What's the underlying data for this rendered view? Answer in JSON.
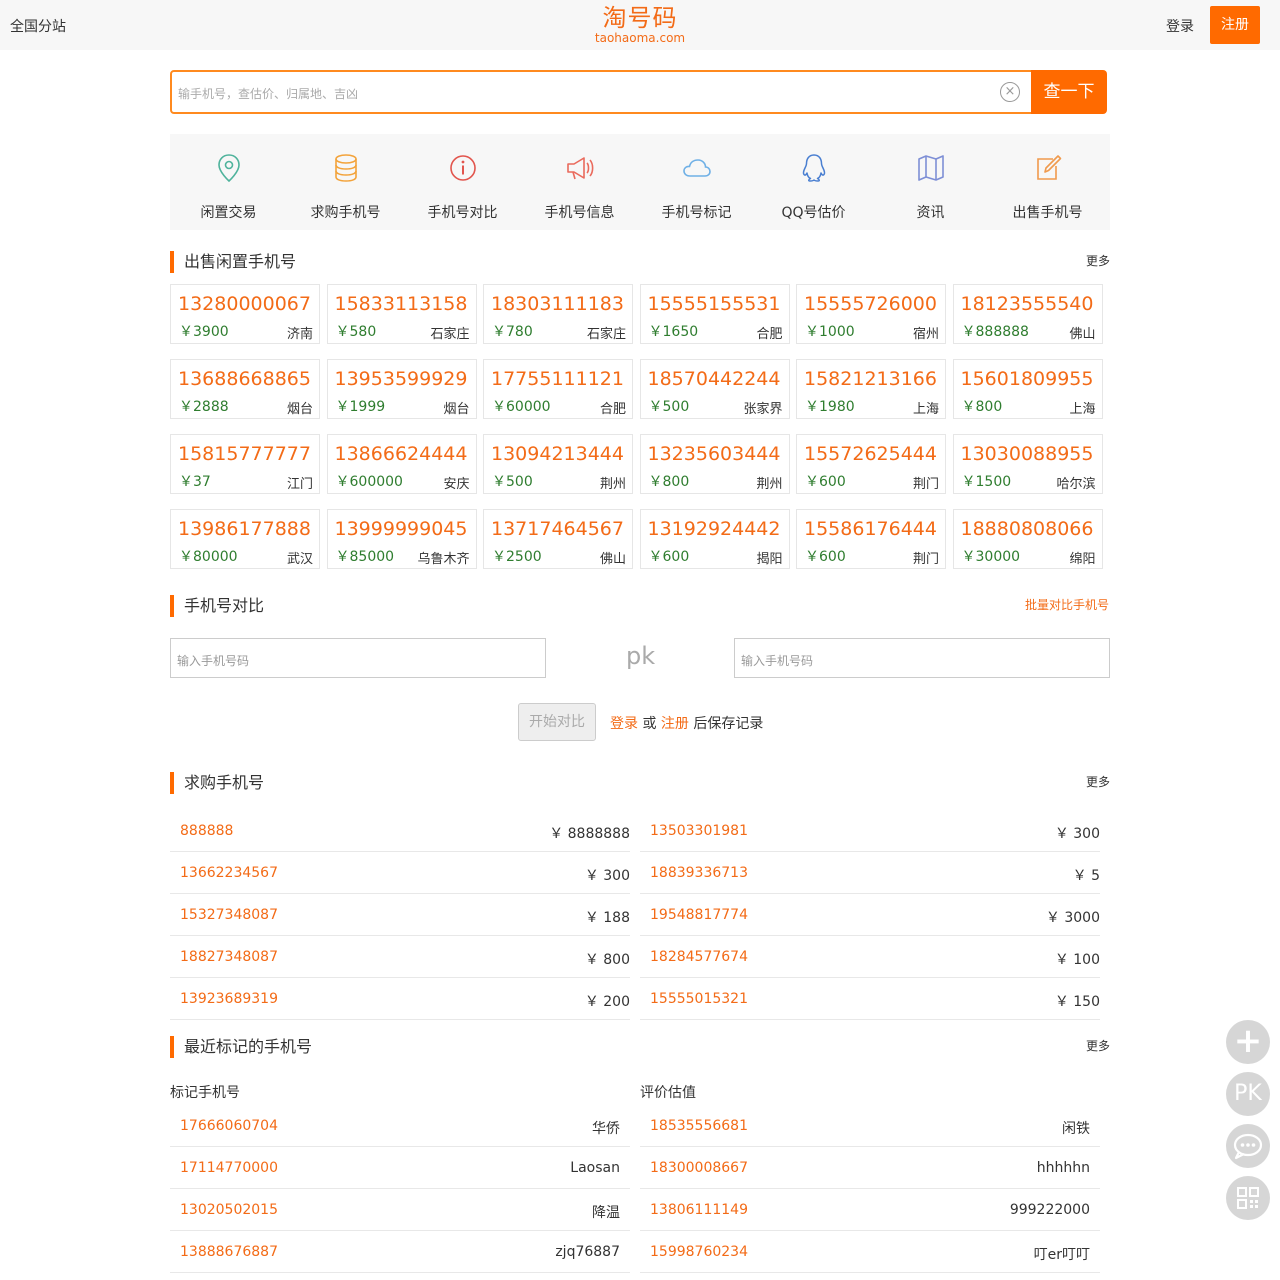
{
  "header": {
    "city": "全国分站",
    "logo_cn": "淘号码",
    "logo_en": "taohaoma.com",
    "login": "登录",
    "register": "注册"
  },
  "search": {
    "placeholder": "输手机号，查估价、归属地、吉凶",
    "button": "查一下",
    "clear_icon": "close-circle-icon"
  },
  "nav": [
    {
      "label": "闲置交易",
      "icon": "location-pin-icon",
      "color": "#4fb39c"
    },
    {
      "label": "求购手机号",
      "icon": "coin-stack-icon",
      "color": "#f3a33b"
    },
    {
      "label": "手机号对比",
      "icon": "info-circle-icon",
      "color": "#e2554d"
    },
    {
      "label": "手机号信息",
      "icon": "megaphone-icon",
      "color": "#ea6a5c"
    },
    {
      "label": "手机号标记",
      "icon": "cloud-icon",
      "color": "#6fb0e6"
    },
    {
      "label": "QQ号估价",
      "icon": "qq-penguin-icon",
      "color": "#4a7fd1"
    },
    {
      "label": "资讯",
      "icon": "map-icon",
      "color": "#7e8fd6"
    },
    {
      "label": "出售手机号",
      "icon": "edit-icon",
      "color": "#f09a4d"
    }
  ],
  "sale": {
    "title": "出售闲置手机号",
    "more": "更多",
    "items": [
      {
        "number": "13280000067",
        "price": "￥3900",
        "city": "济南"
      },
      {
        "number": "15833113158",
        "price": "￥580",
        "city": "石家庄"
      },
      {
        "number": "18303111183",
        "price": "￥780",
        "city": "石家庄"
      },
      {
        "number": "15555155531",
        "price": "￥1650",
        "city": "合肥"
      },
      {
        "number": "15555726000",
        "price": "￥1000",
        "city": "宿州"
      },
      {
        "number": "18123555540",
        "price": "￥888888",
        "city": "佛山"
      },
      {
        "number": "13688668865",
        "price": "￥2888",
        "city": "烟台"
      },
      {
        "number": "13953599929",
        "price": "￥1999",
        "city": "烟台"
      },
      {
        "number": "17755111121",
        "price": "￥60000",
        "city": "合肥"
      },
      {
        "number": "18570442244",
        "price": "￥500",
        "city": "张家界"
      },
      {
        "number": "15821213166",
        "price": "￥1980",
        "city": "上海"
      },
      {
        "number": "15601809955",
        "price": "￥800",
        "city": "上海"
      },
      {
        "number": "15815777777",
        "price": "￥37",
        "city": "江门"
      },
      {
        "number": "13866624444",
        "price": "￥600000",
        "city": "安庆"
      },
      {
        "number": "13094213444",
        "price": "￥500",
        "city": "荆州"
      },
      {
        "number": "13235603444",
        "price": "￥800",
        "city": "荆州"
      },
      {
        "number": "15572625444",
        "price": "￥600",
        "city": "荆门"
      },
      {
        "number": "13030088955",
        "price": "￥1500",
        "city": "哈尔滨"
      },
      {
        "number": "13986177888",
        "price": "￥80000",
        "city": "武汉"
      },
      {
        "number": "13999999045",
        "price": "￥85000",
        "city": "乌鲁木齐"
      },
      {
        "number": "13717464567",
        "price": "￥2500",
        "city": "佛山"
      },
      {
        "number": "13192924442",
        "price": "￥600",
        "city": "揭阳"
      },
      {
        "number": "15586176444",
        "price": "￥600",
        "city": "荆门"
      },
      {
        "number": "18880808066",
        "price": "￥30000",
        "city": "绵阳"
      }
    ]
  },
  "compare": {
    "title": "手机号对比",
    "batch_link": "批量对比手机号",
    "input1_placeholder": "输入手机号码",
    "input2_placeholder": "输入手机号码",
    "pk": "pk",
    "button": "开始对比",
    "note_login": "登录",
    "note_or": " 或 ",
    "note_register": "注册",
    "note_suffix": " 后保存记录"
  },
  "wanted": {
    "title": "求购手机号",
    "more": "更多",
    "left": [
      {
        "number": "888888",
        "price": "￥ 8888888"
      },
      {
        "number": "13662234567",
        "price": "￥ 300"
      },
      {
        "number": "15327348087",
        "price": "￥ 188"
      },
      {
        "number": "18827348087",
        "price": "￥ 800"
      },
      {
        "number": "13923689319",
        "price": "￥ 200"
      }
    ],
    "right": [
      {
        "number": "13503301981",
        "price": "￥ 300"
      },
      {
        "number": "18839336713",
        "price": "￥ 5"
      },
      {
        "number": "19548817774",
        "price": "￥ 3000"
      },
      {
        "number": "18284577674",
        "price": "￥ 100"
      },
      {
        "number": "15555015321",
        "price": "￥ 150"
      }
    ]
  },
  "marked": {
    "title": "最近标记的手机号",
    "more": "更多",
    "left_head": "标记手机号",
    "right_head": "评价估值",
    "left": [
      {
        "number": "17666060704",
        "value": "华侨"
      },
      {
        "number": "17114770000",
        "value": "Laosan"
      },
      {
        "number": "13020502015",
        "value": "降温"
      },
      {
        "number": "13888676887",
        "value": "zjq76887"
      }
    ],
    "right": [
      {
        "number": "18535556681",
        "value": "闲铁"
      },
      {
        "number": "18300008667",
        "value": "hhhhhn"
      },
      {
        "number": "13806111149",
        "value": "999222000"
      },
      {
        "number": "15998760234",
        "value": "叮er叮叮"
      }
    ]
  },
  "fabs": {
    "plus_icon": "plus-icon",
    "pk": "PK",
    "chat_icon": "chat-bubble-icon",
    "qr_icon": "qr-code-icon"
  }
}
